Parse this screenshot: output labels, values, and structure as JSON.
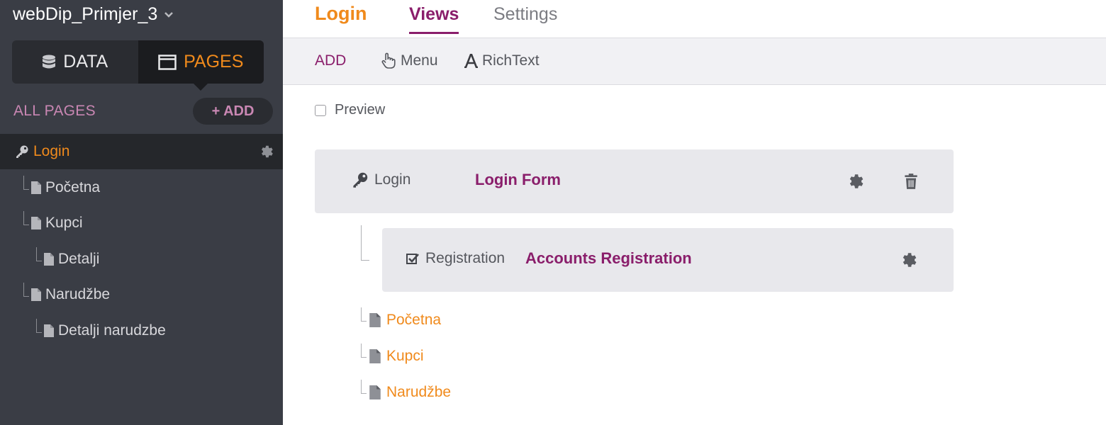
{
  "app": {
    "title": "webDip_Primjer_3"
  },
  "sidebar": {
    "segments": [
      {
        "label": "DATA"
      },
      {
        "label": "PAGES"
      }
    ],
    "section_label": "ALL PAGES",
    "add_label": "+ ADD",
    "tree": [
      {
        "label": "Login"
      },
      {
        "label": "Početna"
      },
      {
        "label": "Kupci"
      },
      {
        "label": "Detalji"
      },
      {
        "label": "Narudžbe"
      },
      {
        "label": "Detalji narudzbe"
      }
    ]
  },
  "header": {
    "page_name": "Login",
    "tabs": [
      {
        "label": "Views"
      },
      {
        "label": "Settings"
      }
    ]
  },
  "toolbar": {
    "add": "ADD",
    "menu": "Menu",
    "richtext": "RichText"
  },
  "preview": {
    "label": "Preview",
    "checked": false
  },
  "views": [
    {
      "type": "Login",
      "name": "Login Form"
    },
    {
      "type": "Registration",
      "name": "Accounts Registration"
    }
  ],
  "child_pages": [
    {
      "label": "Početna"
    },
    {
      "label": "Kupci"
    },
    {
      "label": "Narudžbe"
    }
  ],
  "colors": {
    "accent_orange": "#f08a1c",
    "accent_purple": "#8a1e6b",
    "sidebar_bg": "#3a3d45"
  }
}
